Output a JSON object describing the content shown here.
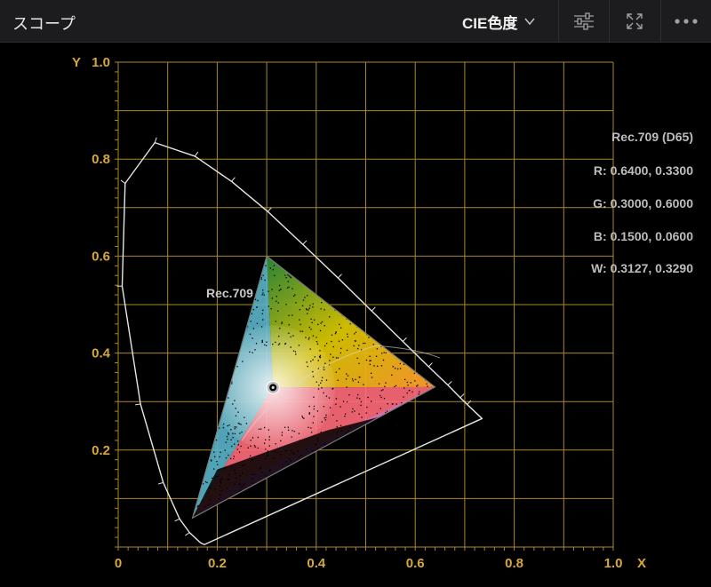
{
  "header": {
    "title": "スコープ",
    "scope_type": "CIE色度",
    "icons": [
      "sliders-icon",
      "expand-icon",
      "more-icon"
    ]
  },
  "axes": {
    "x_label": "X",
    "y_label": "Y",
    "x_ticks": [
      "0",
      "0.2",
      "0.4",
      "0.6",
      "0.8",
      "1.0"
    ],
    "y_ticks": [
      "1.0",
      "0.8",
      "0.6",
      "0.4",
      "0.2"
    ],
    "xlim": [
      0,
      1.0
    ],
    "ylim": [
      0,
      1.0
    ],
    "grid_color": "#a8882d",
    "label_color": "#d6a83a"
  },
  "gamut": {
    "label": "Rec.709",
    "standard": "Rec.709 (D65)",
    "r": "R: 0.6400, 0.3300",
    "g": "G: 0.3000, 0.6000",
    "b": "B: 0.1500, 0.0600",
    "w": "W: 0.3127, 0.3290",
    "primaries": {
      "r": [
        0.64,
        0.33
      ],
      "g": [
        0.3,
        0.6
      ],
      "b": [
        0.15,
        0.06
      ]
    },
    "white_point": [
      0.3127,
      0.329
    ]
  }
}
